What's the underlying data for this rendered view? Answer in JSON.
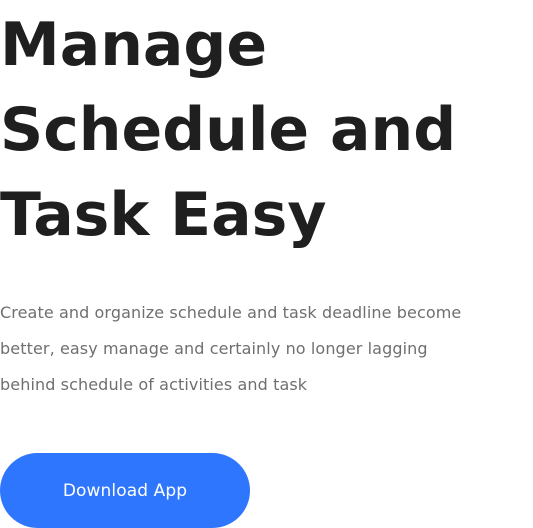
{
  "hero": {
    "title_lines": [
      "Manage",
      "Schedule and",
      "Task Easy"
    ],
    "description_lines": [
      "Create and organize schedule and task deadline become",
      "better, easy manage and certainly no longer lagging",
      "behind schedule of activities and task"
    ],
    "cta_label": "Download App",
    "colors": {
      "title": "#1f1f1f",
      "description": "#6f6f6f",
      "button_bg": "#2f76ff",
      "button_text": "#ffffff"
    }
  }
}
